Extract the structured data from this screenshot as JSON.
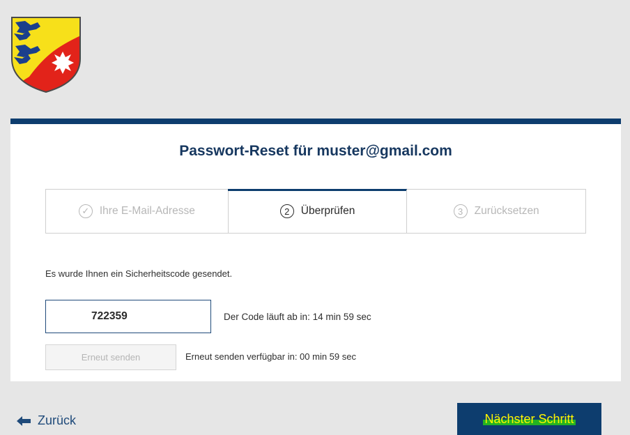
{
  "logo": {
    "icon": "coat-of-arms-icon",
    "colors": {
      "lions_bg": "#f7e01a",
      "lions": "#1b3f8c",
      "red_field": "#e2231a",
      "leaf": "#ffffff"
    }
  },
  "card": {
    "title": "Passwort-Reset für muster@gmail.com",
    "accent_color": "#0d3d6e"
  },
  "steps": [
    {
      "number": "✓",
      "label": "Ihre E-Mail-Adresse",
      "state": "done"
    },
    {
      "number": "2",
      "label": "Überprüfen",
      "state": "active"
    },
    {
      "number": "3",
      "label": "Zurücksetzen",
      "state": "pending"
    }
  ],
  "verification": {
    "info_text": "Es wurde Ihnen ein Sicherheitscode gesendet.",
    "code_value": "722359",
    "expiry_text": "Der Code läuft ab in: 14 min 59 sec",
    "resend_label": "Erneut senden",
    "resend_info": "Erneut senden verfügbar in: 00 min 59 sec"
  },
  "footer": {
    "back_label": "Zurück",
    "back_icon": "arrow-left-icon",
    "next_label": "Nächster Schritt"
  }
}
